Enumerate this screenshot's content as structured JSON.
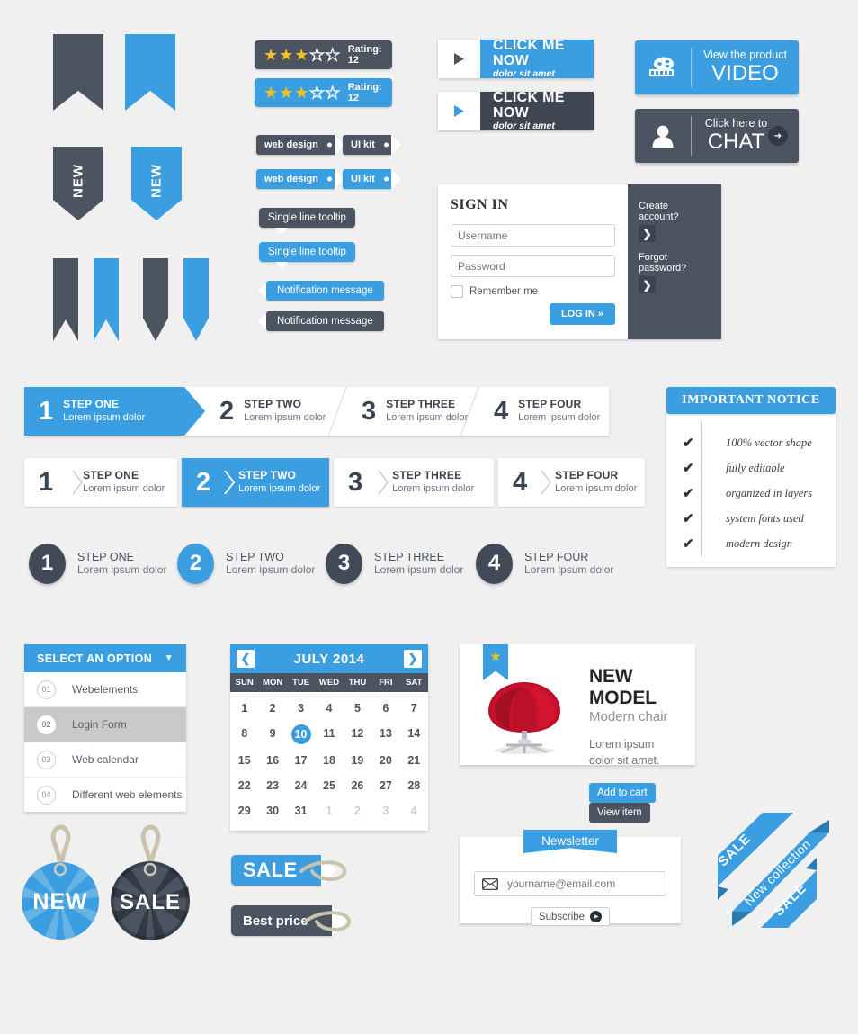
{
  "theme": {
    "blue": "#3b9ee0",
    "dark": "#4c5461",
    "bg": "#f0f0f0",
    "star": "#f5c11e"
  },
  "bookmarks": {
    "new_label": "NEW"
  },
  "ratings": [
    {
      "label": "Rating: 12",
      "filled": 3,
      "total": 5,
      "style": "dark"
    },
    {
      "label": "Rating: 12",
      "filled": 3,
      "total": 5,
      "style": "blue"
    }
  ],
  "tags": [
    {
      "label": "web design",
      "style": "dark"
    },
    {
      "label": "UI kit",
      "style": "dark"
    },
    {
      "label": "web design",
      "style": "blue"
    },
    {
      "label": "UI kit",
      "style": "blue"
    }
  ],
  "tooltips": [
    {
      "label": "Single line tooltip",
      "style": "dark"
    },
    {
      "label": "Single line tooltip",
      "style": "blue"
    }
  ],
  "notifications": [
    {
      "label": "Notification message",
      "style": "blue"
    },
    {
      "label": "Notification message",
      "style": "dark"
    }
  ],
  "cta_buttons": [
    {
      "title": "CLICK ME NOW",
      "subtitle": "dolor sit amet",
      "style": "blue",
      "icon": "play-icon"
    },
    {
      "title": "CLICK ME NOW",
      "subtitle": "dolor sit amet",
      "style": "dark",
      "icon": "play-icon"
    }
  ],
  "media_buttons": [
    {
      "line1": "View the product",
      "line2": "VIDEO",
      "style": "blue",
      "icon": "film-reel-icon"
    },
    {
      "line1": "Click here to",
      "line2": "CHAT",
      "style": "dark",
      "icon": "user-icon"
    }
  ],
  "signin": {
    "title": "SIGN IN",
    "username_placeholder": "Username",
    "password_placeholder": "Password",
    "remember_label": "Remember me",
    "login_label": "LOG IN »",
    "create_account_label": "Create account?",
    "forgot_password_label": "Forgot password?",
    "arrow_glyph": "❯"
  },
  "steps_arrow": [
    {
      "num": "1",
      "title": "STEP ONE",
      "desc": "Lorem ipsum dolor",
      "active": true
    },
    {
      "num": "2",
      "title": "STEP TWO",
      "desc": "Lorem ipsum dolor",
      "active": false
    },
    {
      "num": "3",
      "title": "STEP THREE",
      "desc": "Lorem ipsum dolor",
      "active": false
    },
    {
      "num": "4",
      "title": "STEP FOUR",
      "desc": "Lorem ipsum dolor",
      "active": false
    }
  ],
  "steps_chevron": [
    {
      "num": "1",
      "title": "STEP ONE",
      "desc": "Lorem ipsum dolor",
      "active": false
    },
    {
      "num": "2",
      "title": "STEP TWO",
      "desc": "Lorem ipsum dolor",
      "active": true
    },
    {
      "num": "3",
      "title": "STEP THREE",
      "desc": "Lorem ipsum dolor",
      "active": false
    },
    {
      "num": "4",
      "title": "STEP FOUR",
      "desc": "Lorem ipsum dolor",
      "active": false
    }
  ],
  "steps_circle": [
    {
      "num": "1",
      "title": "STEP ONE",
      "desc": "Lorem ipsum dolor",
      "active": false
    },
    {
      "num": "2",
      "title": "STEP TWO",
      "desc": "Lorem ipsum dolor",
      "active": true
    },
    {
      "num": "3",
      "title": "STEP THREE",
      "desc": "Lorem ipsum dolor",
      "active": false
    },
    {
      "num": "4",
      "title": "STEP FOUR",
      "desc": "Lorem ipsum dolor",
      "active": false
    }
  ],
  "notice": {
    "title": "IMPORTANT NOTICE",
    "items": [
      "100% vector shape",
      "fully editable",
      "organized in layers",
      "system fonts used",
      "modern design"
    ],
    "check_glyph": "✔"
  },
  "select": {
    "header": "SELECT AN OPTION",
    "caret": "▼",
    "items": [
      {
        "num": "01",
        "label": "Webelements",
        "selected": false
      },
      {
        "num": "02",
        "label": "Login Form",
        "selected": true
      },
      {
        "num": "03",
        "label": "Web calendar",
        "selected": false
      },
      {
        "num": "04",
        "label": "Different web elements",
        "selected": false
      }
    ]
  },
  "calendar": {
    "title": "JULY 2014",
    "prev_glyph": "❮",
    "next_glyph": "❯",
    "dow": [
      "SUN",
      "MON",
      "TUE",
      "WED",
      "THU",
      "FRI",
      "SAT"
    ],
    "today": 10,
    "days": [
      {
        "d": "1"
      },
      {
        "d": "2"
      },
      {
        "d": "3"
      },
      {
        "d": "4"
      },
      {
        "d": "5"
      },
      {
        "d": "6"
      },
      {
        "d": "7"
      },
      {
        "d": "8"
      },
      {
        "d": "9"
      },
      {
        "d": "10",
        "today": true
      },
      {
        "d": "11"
      },
      {
        "d": "12"
      },
      {
        "d": "13"
      },
      {
        "d": "14"
      },
      {
        "d": "15"
      },
      {
        "d": "16"
      },
      {
        "d": "17"
      },
      {
        "d": "18"
      },
      {
        "d": "19"
      },
      {
        "d": "20"
      },
      {
        "d": "21"
      },
      {
        "d": "22"
      },
      {
        "d": "23"
      },
      {
        "d": "24"
      },
      {
        "d": "25"
      },
      {
        "d": "26"
      },
      {
        "d": "27"
      },
      {
        "d": "28"
      },
      {
        "d": "29"
      },
      {
        "d": "30"
      },
      {
        "d": "31"
      },
      {
        "d": "1",
        "mut": true
      },
      {
        "d": "2",
        "mut": true
      },
      {
        "d": "3",
        "mut": true
      },
      {
        "d": "4",
        "mut": true
      }
    ]
  },
  "product": {
    "badge_icon": "star-icon",
    "title": "NEW MODEL",
    "subtitle": "Modern chair",
    "description": "Lorem ipsum dolor sit amet.",
    "add_to_cart_label": "Add to cart",
    "view_item_label": "View item",
    "image_alt": "red-modern-chair"
  },
  "newsletter": {
    "ribbon": "Newsletter",
    "email_placeholder": "yourname@email.com",
    "email_value": "",
    "subscribe_label": "Subscribe",
    "arrow_glyph": "➤",
    "mail_icon": "envelope-icon"
  },
  "badges": [
    {
      "label": "NEW",
      "style": "blue"
    },
    {
      "label": "SALE",
      "style": "dark"
    }
  ],
  "price_tags": [
    {
      "label": "SALE",
      "style": "blue"
    },
    {
      "label": "Best price",
      "style": "dark"
    }
  ],
  "corner_ribbons": [
    {
      "label": "SALE"
    },
    {
      "label": "New collection"
    },
    {
      "label": "SALE"
    }
  ]
}
